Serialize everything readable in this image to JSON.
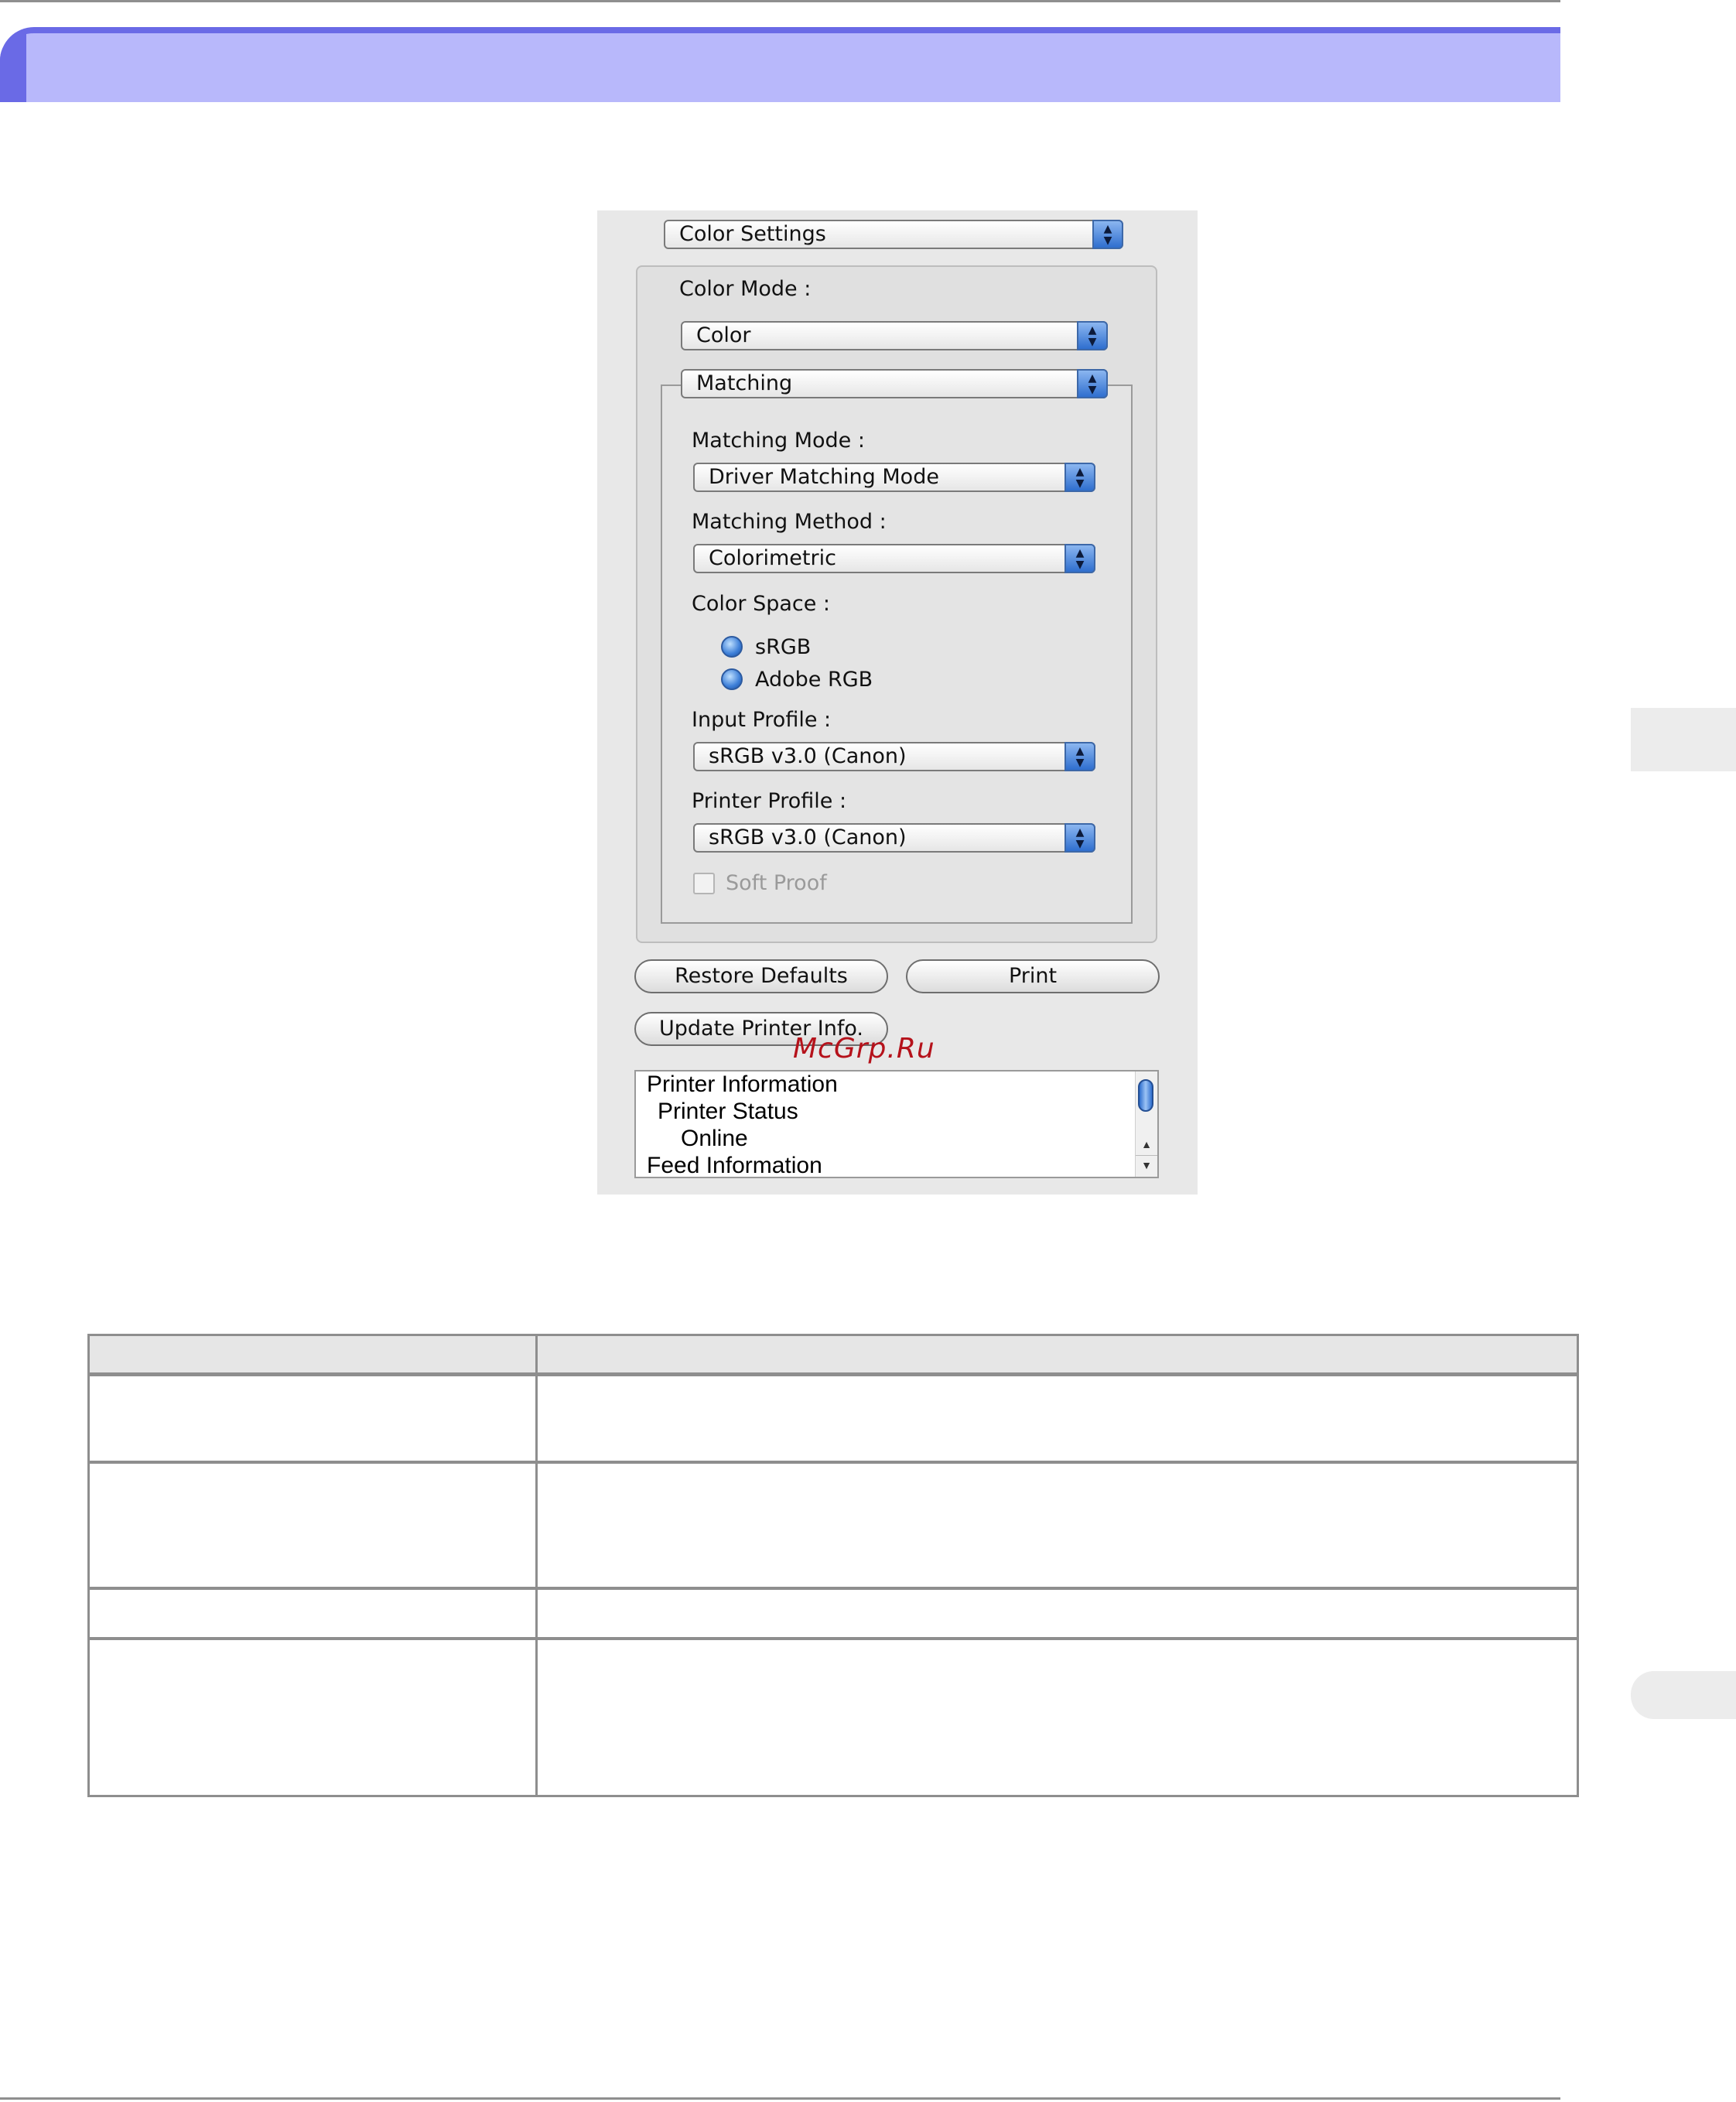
{
  "dialog": {
    "panel_popup": "Color Settings",
    "color_mode": {
      "label": "Color Mode :",
      "value": "Color"
    },
    "section_popup": "Matching",
    "matching_mode": {
      "label": "Matching Mode :",
      "value": "Driver Matching Mode"
    },
    "matching_method": {
      "label": "Matching Method :",
      "value": "Colorimetric"
    },
    "color_space": {
      "label": "Color Space :",
      "options": [
        "sRGB",
        "Adobe RGB"
      ]
    },
    "input_profile": {
      "label": "Input Profile :",
      "value": "sRGB v3.0 (Canon)"
    },
    "printer_profile": {
      "label": "Printer Profile :",
      "value": "sRGB v3.0 (Canon)"
    },
    "soft_proof_label": "Soft Proof",
    "buttons": {
      "restore_defaults": "Restore Defaults",
      "print": "Print",
      "update_printer_info": "Update Printer Info."
    },
    "info_list": [
      "Printer Information",
      "Printer Status",
      "Online",
      "Feed Information"
    ]
  },
  "watermark": "McGrp.Ru",
  "colors": {
    "header_bar": "#b8b8fb",
    "header_accent": "#6a6ae6",
    "dialog_bg": "#e8e8e8",
    "watermark": "#b5121b"
  }
}
